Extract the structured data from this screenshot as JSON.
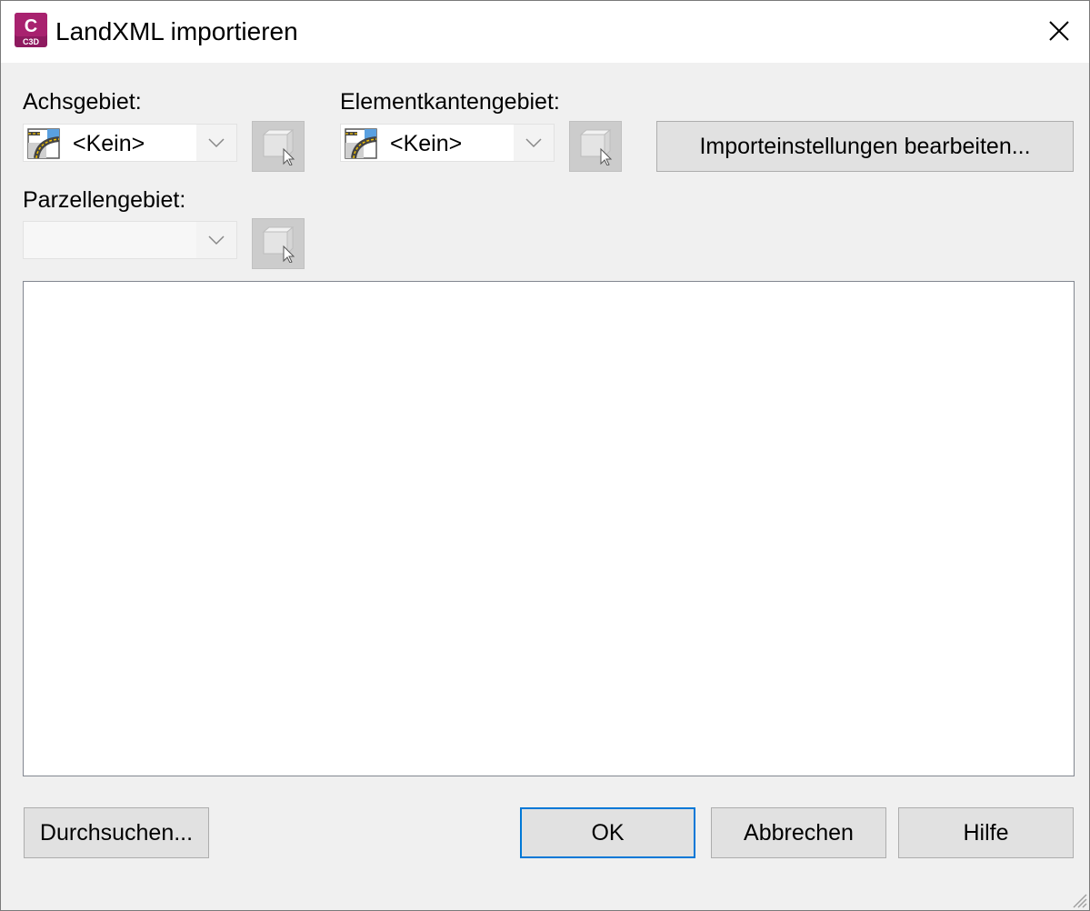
{
  "window": {
    "title": "LandXML importieren",
    "app_icon": {
      "letter": "C",
      "badge": "C3D",
      "color": "#8e1a5f"
    }
  },
  "alignment_site": {
    "label": "Achsgebiet:",
    "value": "<Kein>"
  },
  "featureline_site": {
    "label": "Elementkantengebiet:",
    "value": "<Kein>"
  },
  "parcel_site": {
    "label": "Parzellengebiet:",
    "value": ""
  },
  "buttons": {
    "import_settings": "Importeinstellungen bearbeiten...",
    "browse": "Durchsuchen...",
    "ok": "OK",
    "cancel": "Abbrechen",
    "help": "Hilfe"
  },
  "colors": {
    "accent": "#0078d7"
  }
}
